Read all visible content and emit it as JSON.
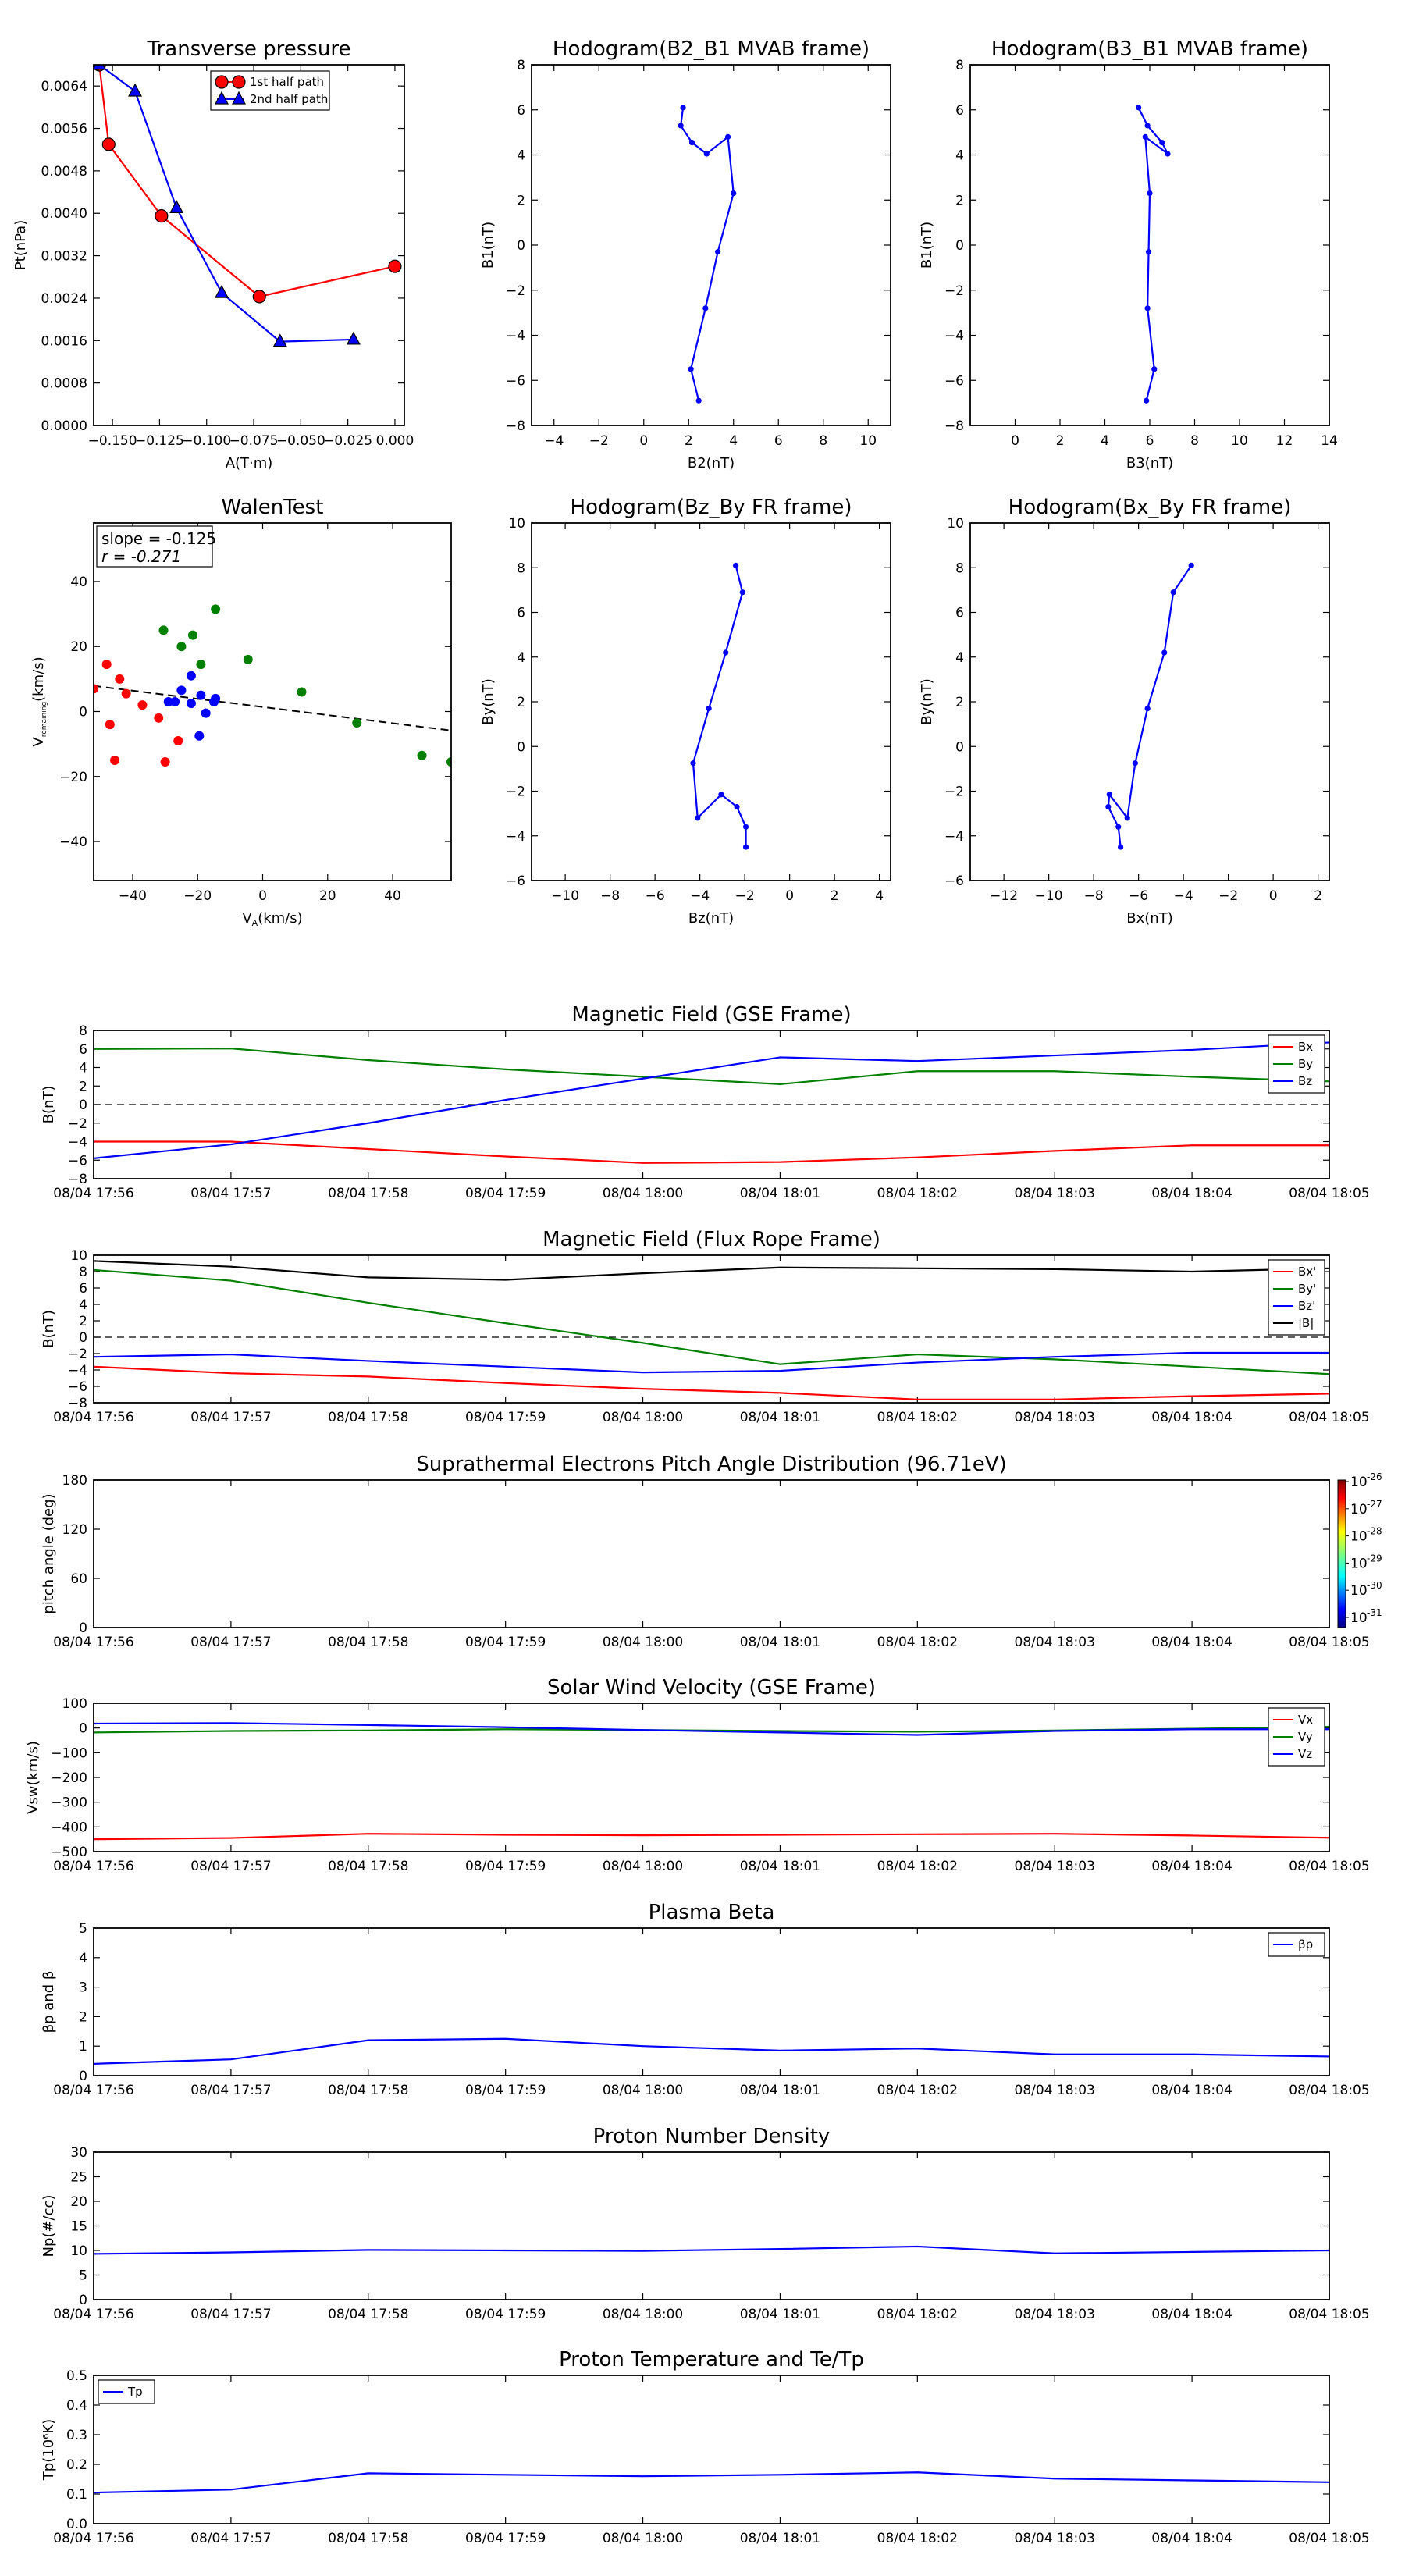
{
  "chart_data": [
    {
      "id": "tp",
      "type": "line",
      "title": "Transverse pressure",
      "xlabel": "A(T·m)",
      "ylabel": "Pt(nPa)",
      "xlim": [
        -0.16,
        0.005
      ],
      "ylim": [
        0,
        0.0068
      ],
      "xticks": [
        -0.15,
        -0.125,
        -0.1,
        -0.075,
        -0.05,
        -0.025,
        0.0
      ],
      "xticklabels": [
        "−0.150",
        "−0.125",
        "−0.100",
        "−0.075",
        "−0.050",
        "−0.025",
        "0.000"
      ],
      "yticks": [
        0,
        0.0008,
        0.0016,
        0.0024,
        0.0032,
        0.004,
        0.0048,
        0.0056,
        0.0064
      ],
      "yticklabels": [
        "0.0000",
        "0.0008",
        "0.0016",
        "0.0024",
        "0.0032",
        "0.0040",
        "0.0048",
        "0.0056",
        "0.0064"
      ],
      "legend": "upper-center",
      "series": [
        {
          "name": "1st half path",
          "color": "#ff0000",
          "marker": "circle",
          "x": [
            -0.157,
            -0.152,
            -0.124,
            -0.072,
            0.0
          ],
          "y": [
            0.0068,
            0.0053,
            0.00395,
            0.00243,
            0.003
          ]
        },
        {
          "name": "2nd half path",
          "color": "#0000ff",
          "marker": "triangle",
          "x": [
            -0.157,
            -0.138,
            -0.116,
            -0.092,
            -0.061,
            -0.022
          ],
          "y": [
            0.0068,
            0.0063,
            0.0041,
            0.0025,
            0.00158,
            0.00162
          ]
        }
      ]
    },
    {
      "id": "h1",
      "type": "line",
      "title": "Hodogram(B2_B1 MVAB frame)",
      "xlabel": "B2(nT)",
      "ylabel": "B1(nT)",
      "xlim": [
        -5,
        11
      ],
      "ylim": [
        -8,
        8
      ],
      "xticks": [
        -4,
        -2,
        0,
        2,
        4,
        6,
        8,
        10
      ],
      "xticklabels": [
        "−4",
        "−2",
        "0",
        "2",
        "4",
        "6",
        "8",
        "10"
      ],
      "yticks": [
        -8,
        -6,
        -4,
        -2,
        0,
        2,
        4,
        6,
        8
      ],
      "yticklabels": [
        "−8",
        "−6",
        "−4",
        "−2",
        "0",
        "2",
        "4",
        "6",
        "8"
      ],
      "series": [
        {
          "color": "#0000ff",
          "marker": "dot",
          "x": [
            1.75,
            1.65,
            2.15,
            2.8,
            3.75,
            4.0,
            3.3,
            2.75,
            2.1,
            2.45
          ],
          "y": [
            6.1,
            5.3,
            4.55,
            4.05,
            4.8,
            2.3,
            -0.3,
            -2.8,
            -5.5,
            -6.9
          ]
        }
      ]
    },
    {
      "id": "h2",
      "type": "line",
      "title": "Hodogram(B3_B1 MVAB frame)",
      "xlabel": "B3(nT)",
      "ylabel": "B1(nT)",
      "xlim": [
        -2,
        14
      ],
      "ylim": [
        -8,
        8
      ],
      "xticks": [
        0,
        2,
        4,
        6,
        8,
        10,
        12,
        14
      ],
      "xticklabels": [
        "0",
        "2",
        "4",
        "6",
        "8",
        "10",
        "12",
        "14"
      ],
      "yticks": [
        -8,
        -6,
        -4,
        -2,
        0,
        2,
        4,
        6,
        8
      ],
      "yticklabels": [
        "−8",
        "−6",
        "−4",
        "−2",
        "0",
        "2",
        "4",
        "6",
        "8"
      ],
      "series": [
        {
          "color": "#0000ff",
          "marker": "dot",
          "x": [
            5.5,
            5.9,
            6.55,
            6.8,
            5.8,
            6.0,
            5.95,
            5.9,
            6.2,
            5.85
          ],
          "y": [
            6.1,
            5.3,
            4.55,
            4.05,
            4.8,
            2.3,
            -0.3,
            -2.8,
            -5.5,
            -6.9
          ]
        }
      ]
    },
    {
      "id": "walen",
      "type": "scatter",
      "title": "WalenTest",
      "xlabel": "V_A(km/s)",
      "ylabel": "V_remaining(km/s)",
      "xlim": [
        -52,
        58
      ],
      "ylim": [
        -52,
        58
      ],
      "xticks": [
        -40,
        -20,
        0,
        20,
        40
      ],
      "xticklabels": [
        "−40",
        "−20",
        "0",
        "20",
        "40"
      ],
      "yticks": [
        -40,
        -20,
        0,
        20,
        40
      ],
      "yticklabels": [
        "−40",
        "−20",
        "0",
        "20",
        "40"
      ],
      "annotation": [
        "slope = -0.125",
        "r = -0.271"
      ],
      "fit": {
        "slope": -0.125,
        "intercept": 1.4
      },
      "groups": [
        {
          "color": "#ff0000",
          "points": [
            [
              -52,
              7
            ],
            [
              -48,
              14.5
            ],
            [
              -47,
              -4
            ],
            [
              -45.5,
              -15
            ],
            [
              -44,
              10
            ],
            [
              -42,
              5.5
            ],
            [
              -37,
              2
            ],
            [
              -32,
              -2
            ],
            [
              -30,
              -15.5
            ],
            [
              -26,
              -9
            ]
          ]
        },
        {
          "color": "#0000ff",
          "points": [
            [
              -29,
              3
            ],
            [
              -27,
              3
            ],
            [
              -25,
              6.5
            ],
            [
              -22,
              11
            ],
            [
              -22,
              2.5
            ],
            [
              -19.5,
              -7.5
            ],
            [
              -19,
              5
            ],
            [
              -17.5,
              -0.5
            ],
            [
              -15,
              3
            ],
            [
              -14.5,
              4
            ]
          ]
        },
        {
          "color": "#008000",
          "points": [
            [
              -30.5,
              25
            ],
            [
              -25,
              20
            ],
            [
              -21.5,
              23.5
            ],
            [
              -19,
              14.5
            ],
            [
              -14.5,
              31.5
            ],
            [
              -4.5,
              16
            ],
            [
              12,
              6
            ],
            [
              29,
              -3.5
            ],
            [
              49,
              -13.5
            ],
            [
              58,
              -15.5
            ]
          ]
        }
      ]
    },
    {
      "id": "h3",
      "type": "line",
      "title": "Hodogram(Bz_By FR frame)",
      "xlabel": "Bz(nT)",
      "ylabel": "By(nT)",
      "xlim": [
        -11.5,
        4.5
      ],
      "ylim": [
        -6,
        10
      ],
      "xticks": [
        -10,
        -8,
        -6,
        -4,
        -2,
        0,
        2,
        4
      ],
      "xticklabels": [
        "−10",
        "−8",
        "−6",
        "−4",
        "−2",
        "0",
        "2",
        "4"
      ],
      "yticks": [
        -6,
        -4,
        -2,
        0,
        2,
        4,
        6,
        8,
        10
      ],
      "yticklabels": [
        "−6",
        "−4",
        "−2",
        "0",
        "2",
        "4",
        "6",
        "8",
        "10"
      ],
      "series": [
        {
          "color": "#0000ff",
          "marker": "dot",
          "x": [
            -2.4,
            -2.1,
            -2.85,
            -3.6,
            -4.3,
            -4.1,
            -3.05,
            -2.35,
            -1.95,
            -1.95
          ],
          "y": [
            8.1,
            6.9,
            4.2,
            1.7,
            -0.75,
            -3.2,
            -2.15,
            -2.7,
            -3.6,
            -4.5
          ]
        }
      ]
    },
    {
      "id": "h4",
      "type": "line",
      "title": "Hodogram(Bx_By FR frame)",
      "xlabel": "Bx(nT)",
      "ylabel": "By(nT)",
      "xlim": [
        -13.5,
        2.5
      ],
      "ylim": [
        -6,
        10
      ],
      "xticks": [
        -12,
        -10,
        -8,
        -6,
        -4,
        -2,
        0,
        2
      ],
      "xticklabels": [
        "−12",
        "−10",
        "−8",
        "−6",
        "−4",
        "−2",
        "0",
        "2"
      ],
      "yticks": [
        -6,
        -4,
        -2,
        0,
        2,
        4,
        6,
        8,
        10
      ],
      "yticklabels": [
        "−6",
        "−4",
        "−2",
        "0",
        "2",
        "4",
        "6",
        "8",
        "10"
      ],
      "series": [
        {
          "color": "#0000ff",
          "marker": "dot",
          "x": [
            -3.65,
            -4.45,
            -4.85,
            -5.6,
            -6.15,
            -6.5,
            -7.3,
            -7.35,
            -6.9,
            -6.8
          ],
          "y": [
            8.1,
            6.9,
            4.2,
            1.7,
            -0.75,
            -3.2,
            -2.15,
            -2.7,
            -3.6,
            -4.5
          ]
        }
      ]
    },
    {
      "id": "mag_gse",
      "type": "line",
      "title": "Magnetic Field (GSE Frame)",
      "ylabel": "B(nT)",
      "xticklabels": [
        "08/04 17:56",
        "08/04 17:57",
        "08/04 17:58",
        "08/04 17:59",
        "08/04 18:00",
        "08/04 18:01",
        "08/04 18:02",
        "08/04 18:03",
        "08/04 18:04",
        "08/04 18:05"
      ],
      "ylim": [
        -8,
        8
      ],
      "yticks": [
        -8,
        -6,
        -4,
        -2,
        0,
        2,
        4,
        6,
        8
      ],
      "yticklabels": [
        "−8",
        "−6",
        "−4",
        "−2",
        "0",
        "2",
        "4",
        "6",
        "8"
      ],
      "zero_line": true,
      "legend": "upper-right",
      "series": [
        {
          "name": "Bx",
          "color": "#ff0000",
          "values": [
            -4.0,
            -4.0,
            -4.8,
            -5.6,
            -6.3,
            -6.2,
            -5.7,
            -5.0,
            -4.4,
            -4.4
          ]
        },
        {
          "name": "By",
          "color": "#008000",
          "values": [
            6.0,
            6.05,
            4.8,
            3.8,
            3.0,
            2.2,
            3.6,
            3.6,
            3.0,
            2.5
          ]
        },
        {
          "name": "Bz",
          "color": "#0000ff",
          "values": [
            -5.8,
            -4.3,
            -2.0,
            0.5,
            2.8,
            5.1,
            4.7,
            5.3,
            5.9,
            6.7
          ]
        }
      ]
    },
    {
      "id": "mag_fr",
      "type": "line",
      "title": "Magnetic Field (Flux Rope Frame)",
      "ylabel": "B(nT)",
      "xticklabels": [
        "08/04 17:56",
        "08/04 17:57",
        "08/04 17:58",
        "08/04 17:59",
        "08/04 18:00",
        "08/04 18:01",
        "08/04 18:02",
        "08/04 18:03",
        "08/04 18:04",
        "08/04 18:05"
      ],
      "ylim": [
        -8,
        10
      ],
      "yticks": [
        -8,
        -6,
        -4,
        -2,
        0,
        2,
        4,
        6,
        8,
        10
      ],
      "yticklabels": [
        "−8",
        "−6",
        "−4",
        "−2",
        "0",
        "2",
        "4",
        "6",
        "8",
        "10"
      ],
      "zero_line": true,
      "legend": "upper-right",
      "series": [
        {
          "name": "Bx'",
          "color": "#ff0000",
          "values": [
            -3.6,
            -4.4,
            -4.8,
            -5.6,
            -6.3,
            -6.8,
            -7.6,
            -7.6,
            -7.2,
            -6.9
          ]
        },
        {
          "name": "By'",
          "color": "#008000",
          "values": [
            8.2,
            6.9,
            4.2,
            1.7,
            -0.7,
            -3.3,
            -2.1,
            -2.7,
            -3.6,
            -4.5
          ]
        },
        {
          "name": "Bz'",
          "color": "#0000ff",
          "values": [
            -2.4,
            -2.1,
            -2.9,
            -3.6,
            -4.3,
            -4.1,
            -3.1,
            -2.4,
            -1.9,
            -1.9
          ]
        },
        {
          "name": "|B|",
          "color": "#000000",
          "values": [
            9.3,
            8.6,
            7.3,
            7.0,
            7.8,
            8.5,
            8.4,
            8.3,
            8.0,
            8.4
          ]
        }
      ]
    },
    {
      "id": "pad",
      "type": "heatmap",
      "title": "Suprathermal Electrons Pitch Angle Distribution (96.71eV)",
      "ylabel": "pitch angle (deg)",
      "xticklabels": [
        "08/04 17:56",
        "08/04 17:57",
        "08/04 17:58",
        "08/04 17:59",
        "08/04 18:00",
        "08/04 18:01",
        "08/04 18:02",
        "08/04 18:03",
        "08/04 18:04",
        "08/04 18:05"
      ],
      "ylim": [
        0,
        180
      ],
      "yticks": [
        0,
        60,
        120,
        180
      ],
      "yticklabels": [
        "0",
        "60",
        "120",
        "180"
      ],
      "colorbar": {
        "ticks": [
          {
            "base": "10",
            "exp": "-26"
          },
          {
            "base": "10",
            "exp": "-27"
          },
          {
            "base": "10",
            "exp": "-28"
          },
          {
            "base": "10",
            "exp": "-29"
          },
          {
            "base": "10",
            "exp": "-30"
          },
          {
            "base": "10",
            "exp": "-31"
          }
        ]
      }
    },
    {
      "id": "vsw",
      "type": "line",
      "title": "Solar Wind Velocity (GSE Frame)",
      "ylabel": "Vsw(km/s)",
      "xticklabels": [
        "08/04 17:56",
        "08/04 17:57",
        "08/04 17:58",
        "08/04 17:59",
        "08/04 18:00",
        "08/04 18:01",
        "08/04 18:02",
        "08/04 18:03",
        "08/04 18:04",
        "08/04 18:05"
      ],
      "ylim": [
        -500,
        100
      ],
      "yticks": [
        -500,
        -400,
        -300,
        -200,
        -100,
        0,
        100
      ],
      "yticklabels": [
        "−500",
        "−400",
        "−300",
        "−200",
        "−100",
        "0",
        "100"
      ],
      "legend": "upper-right",
      "series": [
        {
          "name": "Vx",
          "color": "#ff0000",
          "values": [
            -450,
            -445,
            -428,
            -432,
            -434,
            -432,
            -430,
            -428,
            -435,
            -444
          ]
        },
        {
          "name": "Vy",
          "color": "#008000",
          "values": [
            -18,
            -12,
            -10,
            -5,
            -8,
            -12,
            -15,
            -10,
            -3,
            5
          ]
        },
        {
          "name": "Vz",
          "color": "#0000ff",
          "values": [
            18,
            20,
            12,
            3,
            -8,
            -18,
            -28,
            -12,
            -5,
            -5
          ]
        }
      ]
    },
    {
      "id": "beta",
      "type": "line",
      "title": "Plasma Beta",
      "ylabel": "βp and β",
      "xticklabels": [
        "08/04 17:56",
        "08/04 17:57",
        "08/04 17:58",
        "08/04 17:59",
        "08/04 18:00",
        "08/04 18:01",
        "08/04 18:02",
        "08/04 18:03",
        "08/04 18:04",
        "08/04 18:05"
      ],
      "ylim": [
        0,
        5
      ],
      "yticks": [
        0,
        1,
        2,
        3,
        4,
        5
      ],
      "yticklabels": [
        "0",
        "1",
        "2",
        "3",
        "4",
        "5"
      ],
      "legend": "upper-right",
      "series": [
        {
          "name": "βp",
          "color": "#0000ff",
          "values": [
            0.4,
            0.55,
            1.2,
            1.25,
            1.0,
            0.85,
            0.92,
            0.72,
            0.72,
            0.65
          ]
        }
      ]
    },
    {
      "id": "np",
      "type": "line",
      "title": "Proton Number Density",
      "ylabel": "Np(#/cc)",
      "xticklabels": [
        "08/04 17:56",
        "08/04 17:57",
        "08/04 17:58",
        "08/04 17:59",
        "08/04 18:00",
        "08/04 18:01",
        "08/04 18:02",
        "08/04 18:03",
        "08/04 18:04",
        "08/04 18:05"
      ],
      "ylim": [
        0,
        30
      ],
      "yticks": [
        0,
        5,
        10,
        15,
        20,
        25,
        30
      ],
      "yticklabels": [
        "0",
        "5",
        "10",
        "15",
        "20",
        "25",
        "30"
      ],
      "series": [
        {
          "color": "#0000ff",
          "values": [
            9.3,
            9.6,
            10.1,
            10.0,
            9.9,
            10.3,
            10.8,
            9.4,
            9.7,
            10.0
          ]
        }
      ]
    },
    {
      "id": "tp2",
      "type": "line",
      "title": "Proton Temperature and Te/Tp",
      "ylabel": "Tp(10⁶K)",
      "xticklabels": [
        "08/04 17:56",
        "08/04 17:57",
        "08/04 17:58",
        "08/04 17:59",
        "08/04 18:00",
        "08/04 18:01",
        "08/04 18:02",
        "08/04 18:03",
        "08/04 18:04",
        "08/04 18:05"
      ],
      "ylim": [
        0,
        0.5
      ],
      "yticks": [
        0,
        0.1,
        0.2,
        0.3,
        0.4,
        0.5
      ],
      "yticklabels": [
        "0.0",
        "0.1",
        "0.2",
        "0.3",
        "0.4",
        "0.5"
      ],
      "legend": "upper-left",
      "series": [
        {
          "name": "Tp",
          "color": "#0000ff",
          "values": [
            0.105,
            0.115,
            0.17,
            0.165,
            0.16,
            0.165,
            0.173,
            0.152,
            0.146,
            0.14
          ]
        }
      ]
    }
  ]
}
